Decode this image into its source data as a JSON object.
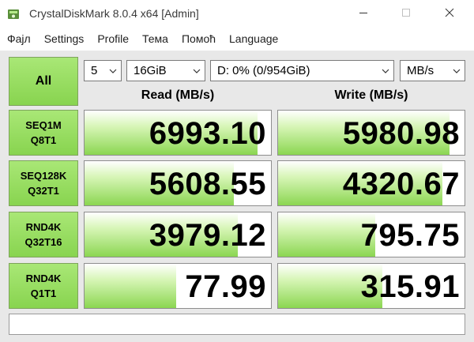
{
  "window": {
    "title": "CrystalDiskMark 8.0.4 x64 [Admin]"
  },
  "menu": [
    "Фајл",
    "Settings",
    "Profile",
    "Тема",
    "Помоћ",
    "Language"
  ],
  "controls": {
    "all_label": "All",
    "count": "5",
    "size": "16GiB",
    "drive": "D: 0% (0/954GiB)",
    "unit": "MB/s"
  },
  "headers": {
    "read": "Read (MB/s)",
    "write": "Write (MB/s)"
  },
  "rows": [
    {
      "line1": "SEQ1M",
      "line2": "Q8T1",
      "read": "6993.10",
      "write": "5980.98",
      "read_fill": 0.93,
      "write_fill": 0.92
    },
    {
      "line1": "SEQ128K",
      "line2": "Q32T1",
      "read": "5608.55",
      "write": "4320.67",
      "read_fill": 0.8,
      "write_fill": 0.88
    },
    {
      "line1": "RND4K",
      "line2": "Q32T16",
      "read": "3979.12",
      "write": "795.75",
      "read_fill": 0.82,
      "write_fill": 0.52
    },
    {
      "line1": "RND4K",
      "line2": "Q1T1",
      "read": "77.99",
      "write": "315.91",
      "read_fill": 0.49,
      "write_fill": 0.56
    }
  ],
  "colors": {
    "accent_green": "#88d44f",
    "bar_green": "#8bd651"
  },
  "comment": ""
}
